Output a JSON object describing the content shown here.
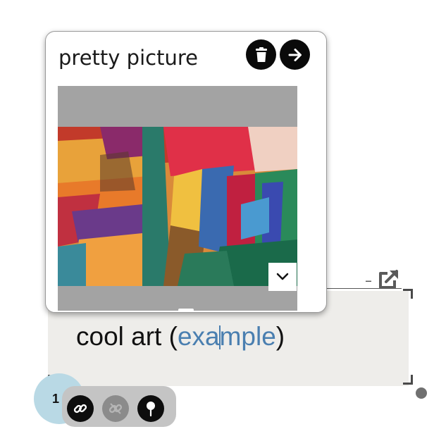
{
  "popup": {
    "title": "pretty picture",
    "delete_icon": "trash-icon",
    "open_icon": "arrow-right-icon",
    "expand_icon": "chevron-down-icon",
    "image_alt": "abstract painting"
  },
  "note": {
    "text_before": "cool art (",
    "link_text_start": "exa",
    "link_text_end": "mple",
    "text_after": ")",
    "minimize_label": "–",
    "open_external_icon": "external-link-icon",
    "link_color": "#4a7fb0",
    "background_color": "#eeedea"
  },
  "footnote": {
    "number": "1",
    "badge_color": "#b9d9e5",
    "tools": [
      {
        "icon": "link-icon",
        "enabled": true
      },
      {
        "icon": "unlink-icon",
        "enabled": false
      },
      {
        "icon": "pin-icon",
        "enabled": true
      }
    ]
  }
}
